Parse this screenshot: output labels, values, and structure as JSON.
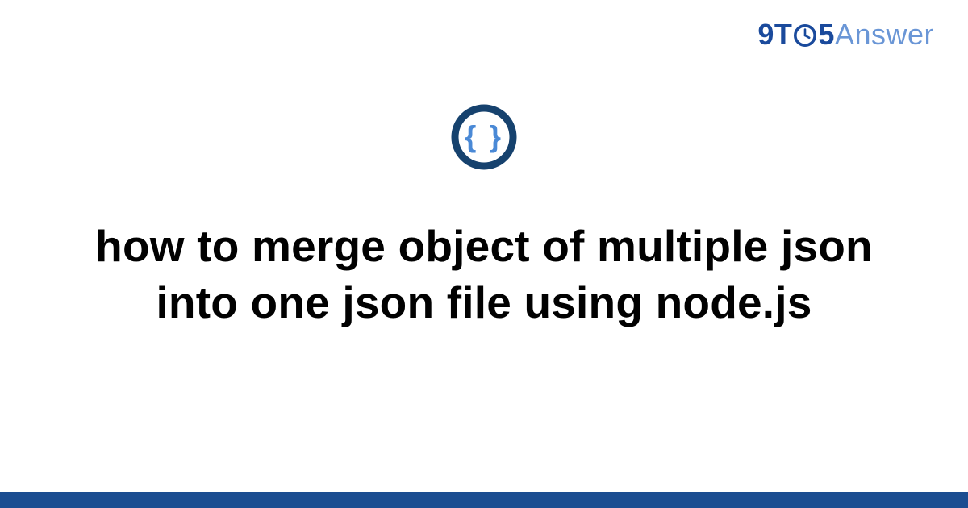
{
  "brand": {
    "part_nine": "9",
    "part_t": "T",
    "part_five": "5",
    "part_answer": "Answer"
  },
  "icon": {
    "name": "json-braces-icon",
    "ring_color": "#16426e",
    "brace_color": "#4a89d6"
  },
  "headline": "how to merge object of multiple json into one json file using node.js",
  "colors": {
    "brand_dark": "#1a4a9c",
    "brand_light": "#6a96d6",
    "footer": "#1b4d91",
    "text": "#010101"
  }
}
